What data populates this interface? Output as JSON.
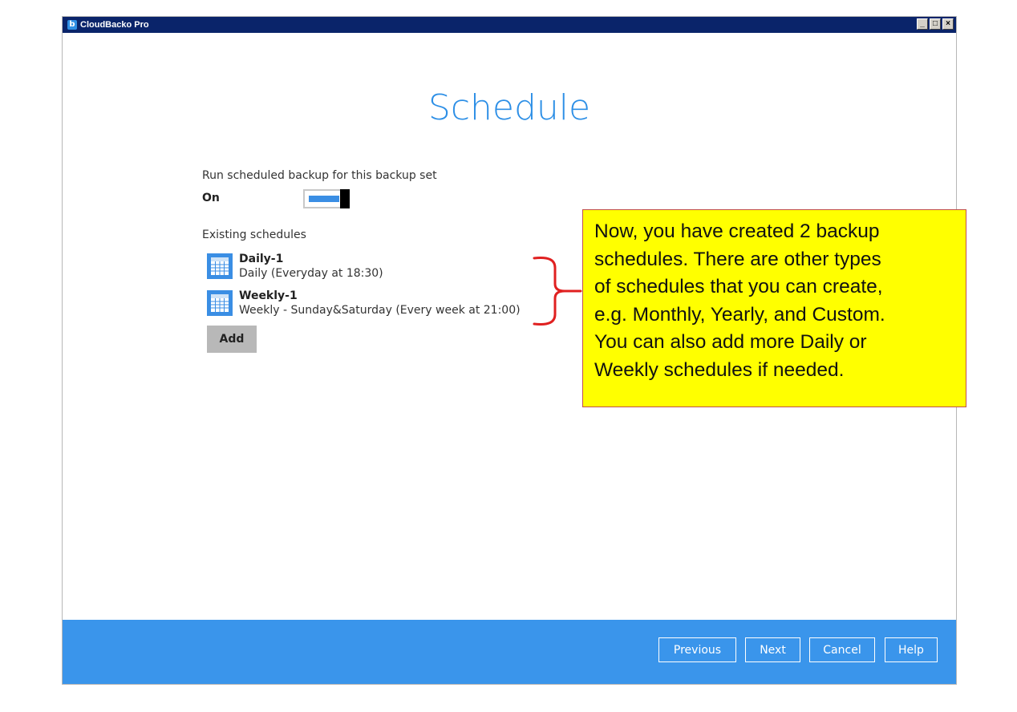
{
  "window": {
    "title": "CloudBacko Pro",
    "controls": {
      "minimize": "_",
      "maximize": "□",
      "close": "×"
    }
  },
  "page": {
    "title": "Schedule",
    "run_label": "Run scheduled backup for this backup set",
    "toggle_state_label": "On",
    "toggle_on": true,
    "existing_label": "Existing schedules"
  },
  "schedules": [
    {
      "name": "Daily-1",
      "description": "Daily (Everyday at 18:30)",
      "icon": "calendar-icon"
    },
    {
      "name": "Weekly-1",
      "description": "Weekly - Sunday&Saturday (Every week at 21:00)",
      "icon": "calendar-icon"
    }
  ],
  "add_label": "Add",
  "callout": {
    "lines": [
      "Now, you have created  2 backup",
      "schedules. There are other types",
      "of schedules that you can create,",
      "e.g. Monthly, Yearly, and Custom.",
      "You can also add more Daily or",
      "Weekly schedules if needed."
    ]
  },
  "footer": {
    "previous": "Previous",
    "next": "Next",
    "cancel": "Cancel",
    "help": "Help"
  },
  "colors": {
    "accent": "#3a95eb",
    "title_blue": "#2d8fe6",
    "callout_bg": "#ffff00",
    "brace_red": "#e02020"
  }
}
